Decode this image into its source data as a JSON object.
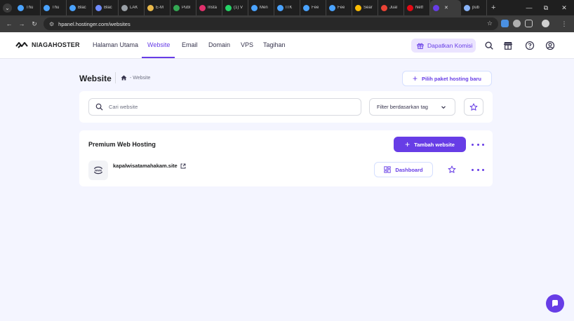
{
  "browser": {
    "tabs": [
      {
        "title": "Thu",
        "color": "#4aa3ff"
      },
      {
        "title": "Thu",
        "color": "#4aa3ff"
      },
      {
        "title": "Blac",
        "color": "#4aa3ff"
      },
      {
        "title": "Blac",
        "color": "#6f8cff"
      },
      {
        "title": "LAK",
        "color": "#9aa0a6"
      },
      {
        "title": "E-M",
        "color": "#e8b84a"
      },
      {
        "title": "Publ",
        "color": "#34a853"
      },
      {
        "title": "Insta",
        "color": "#e1306c"
      },
      {
        "title": "(1) V",
        "color": "#25d366"
      },
      {
        "title": "Men",
        "color": "#4aa3ff"
      },
      {
        "title": "ITK",
        "color": "#4aa3ff"
      },
      {
        "title": "Fee",
        "color": "#4aa3ff"
      },
      {
        "title": "Fee",
        "color": "#4aa3ff"
      },
      {
        "title": "Sear",
        "color": "#fbbc04"
      },
      {
        "title": "Jual",
        "color": "#ea4335"
      },
      {
        "title": "Netf",
        "color": "#e50914"
      },
      {
        "title": "",
        "color": "#673de6",
        "active": true
      },
      {
        "title": "pub",
        "color": "#8ab4f8"
      }
    ],
    "new_tab": "+",
    "window_controls": {
      "minimize": "—",
      "maximize": "⧉",
      "close": "✕"
    },
    "url": "hpanel.hostinger.com/websites"
  },
  "header": {
    "logo_text": "NIAGAHOSTER",
    "nav": [
      {
        "label": "Halaman Utama"
      },
      {
        "label": "Website",
        "active": true
      },
      {
        "label": "Email"
      },
      {
        "label": "Domain"
      },
      {
        "label": "VPS"
      },
      {
        "label": "Tagihan"
      }
    ],
    "komisi_label": "Dapatkan Komisi"
  },
  "page": {
    "title": "Website",
    "breadcrumb": "- Website",
    "add_hosting_label": "Pilih paket hosting baru",
    "search_placeholder": "Cari website",
    "filter_label": "Filter berdasarkan tag"
  },
  "hosting": {
    "title": "Premium Web Hosting",
    "add_website_label": "Tambah website",
    "site": {
      "name": "kapalwisatamahakam.site",
      "dashboard_label": "Dashboard"
    }
  },
  "colors": {
    "accent": "#673de6",
    "accent_light": "#ebe4ff",
    "background": "#f4f5ff"
  }
}
